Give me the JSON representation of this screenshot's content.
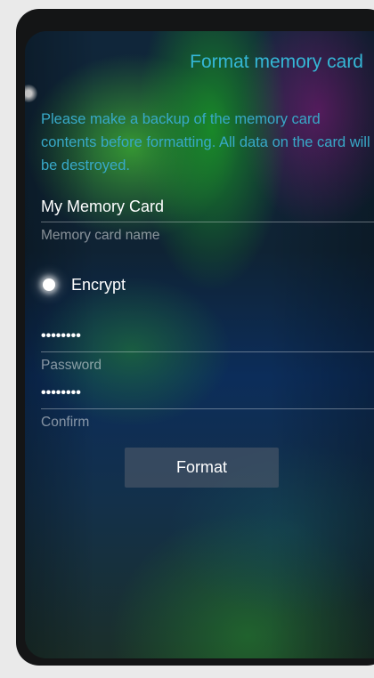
{
  "page": {
    "title": "Format memory card",
    "description": "Please make a backup of the memory card contents before formatting. All data on the card will be destroyed."
  },
  "fields": {
    "card_name": {
      "value": "My Memory Card",
      "label": "Memory card name"
    },
    "encrypt": {
      "label": "Encrypt",
      "checked": true
    },
    "password": {
      "value": "••••••••",
      "label": "Password"
    },
    "confirm": {
      "value": "••••••••",
      "label": "Confirm"
    }
  },
  "actions": {
    "format_label": "Format"
  },
  "colors": {
    "accent": "#35b7d6",
    "text": "#ffffff",
    "secondary": "#9aa7b0"
  }
}
